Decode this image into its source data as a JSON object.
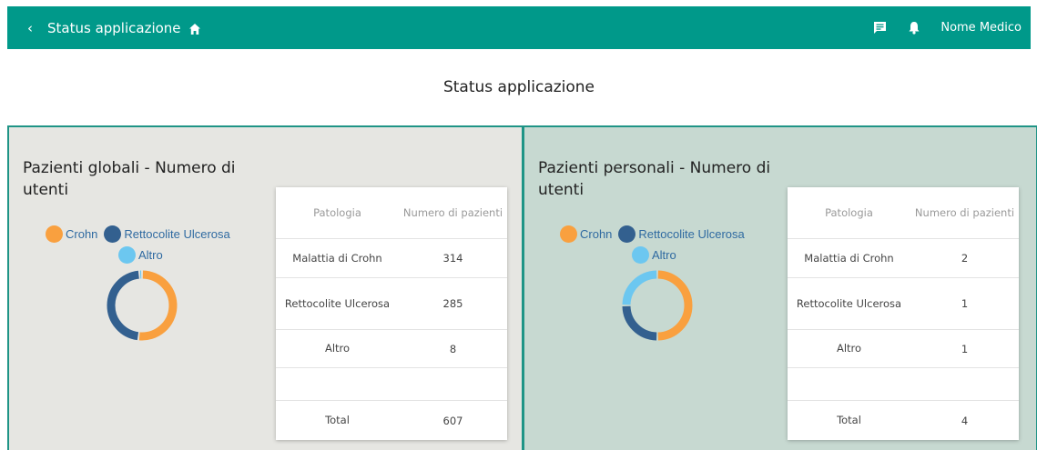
{
  "header": {
    "back_icon": "chevron-left-icon",
    "title": "Status applicazione",
    "home_icon": "home-icon",
    "chat_icon": "chat-icon",
    "bell_icon": "bell-icon",
    "user_name": "Nome Medico",
    "bar_color": "#00998a"
  },
  "page": {
    "title": "Status applicazione"
  },
  "legend": {
    "crohn": "Crohn",
    "rettocolite": "Rettocolite Ulcerosa",
    "altro": "Altro"
  },
  "colors": {
    "crohn": "#f9a03f",
    "rettocolite": "#33608f",
    "altro": "#6cc7f0"
  },
  "table_headers": {
    "patologia": "Patologia",
    "numero": "Numero di pazienti"
  },
  "global": {
    "title": "Pazienti globali - Numero di utenti",
    "rows": [
      {
        "label": "Malattia di Crohn",
        "value": "314"
      },
      {
        "label": "Rettocolite Ulcerosa",
        "value": "285"
      },
      {
        "label": "Altro",
        "value": "8"
      }
    ],
    "total_label": "Total",
    "total_value": "607"
  },
  "personal": {
    "title": "Pazienti personali - Numero di utenti",
    "rows": [
      {
        "label": "Malattia di Crohn",
        "value": "2"
      },
      {
        "label": "Rettocolite Ulcerosa",
        "value": "1"
      },
      {
        "label": "Altro",
        "value": "1"
      }
    ],
    "total_label": "Total",
    "total_value": "4"
  },
  "chart_data": [
    {
      "type": "pie",
      "categories": [
        "Crohn",
        "Rettocolite Ulcerosa",
        "Altro"
      ],
      "values": [
        314,
        285,
        8
      ]
    },
    {
      "type": "pie",
      "categories": [
        "Crohn",
        "Rettocolite Ulcerosa",
        "Altro"
      ],
      "values": [
        2,
        1,
        1
      ]
    }
  ]
}
